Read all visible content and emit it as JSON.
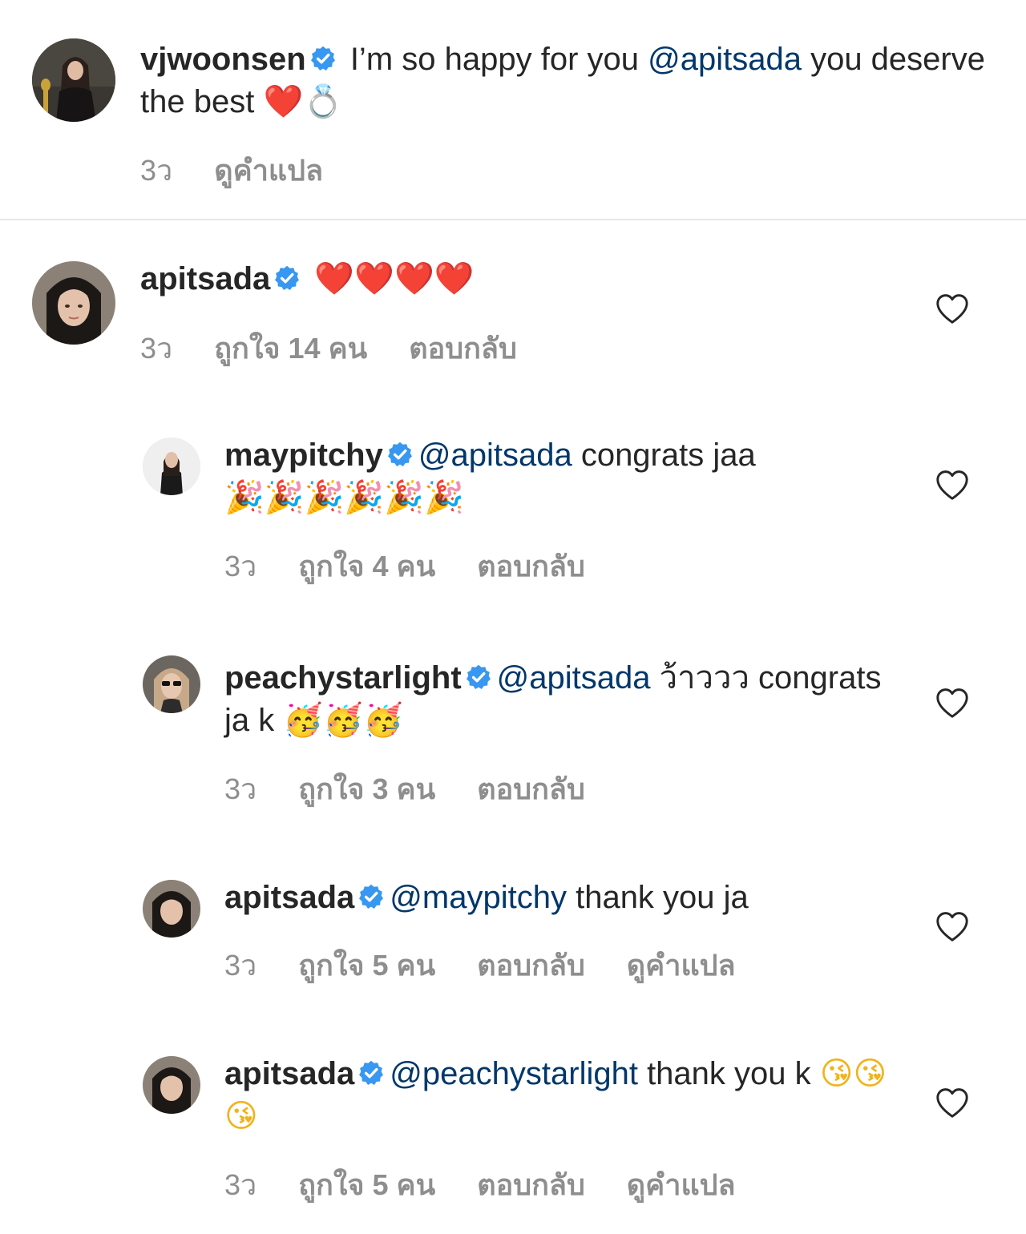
{
  "comments": [
    {
      "username": "vjwoonsen",
      "text_before": " I’m so happy for you ",
      "mention": "@apitsada",
      "text_after": " you deserve the best ",
      "emojis": "❤️💍",
      "time": "3ว",
      "translate": "ดูคำแปล"
    },
    {
      "username": "apitsada",
      "emojis": "❤️❤️❤️❤️",
      "time": "3ว",
      "likes": "ถูกใจ 14 คน",
      "reply": "ตอบกลับ"
    },
    {
      "username": "maypitchy",
      "mention": "@apitsada",
      "text_after": " congrats jaa",
      "emojis": "🎉🎉🎉🎉🎉🎉",
      "time": "3ว",
      "likes": "ถูกใจ 4 คน",
      "reply": "ตอบกลับ"
    },
    {
      "username": "peachystarlight",
      "mention": "@apitsada",
      "text_after": " ว้าววว congrats ja k ",
      "emojis": "🥳🥳🥳",
      "time": "3ว",
      "likes": "ถูกใจ 3 คน",
      "reply": "ตอบกลับ"
    },
    {
      "username": "apitsada",
      "mention": "@maypitchy",
      "text_after": " thank you ja",
      "time": "3ว",
      "likes": "ถูกใจ 5 คน",
      "reply": "ตอบกลับ",
      "translate": "ดูคำแปล"
    },
    {
      "username": "apitsada",
      "mention": "@peachystarlight",
      "text_after": " thank you k ",
      "emojis": "😘😘😘",
      "time": "3ว",
      "likes": "ถูกใจ 5 คน",
      "reply": "ตอบกลับ",
      "translate": "ดูคำแปล"
    }
  ],
  "icons": {
    "verified": "verified-badge-icon",
    "like": "heart-outline-icon"
  },
  "colors": {
    "mention": "#00376b",
    "verified": "#3897f0",
    "meta": "#8e8e8e",
    "heart": "#e0211f"
  }
}
